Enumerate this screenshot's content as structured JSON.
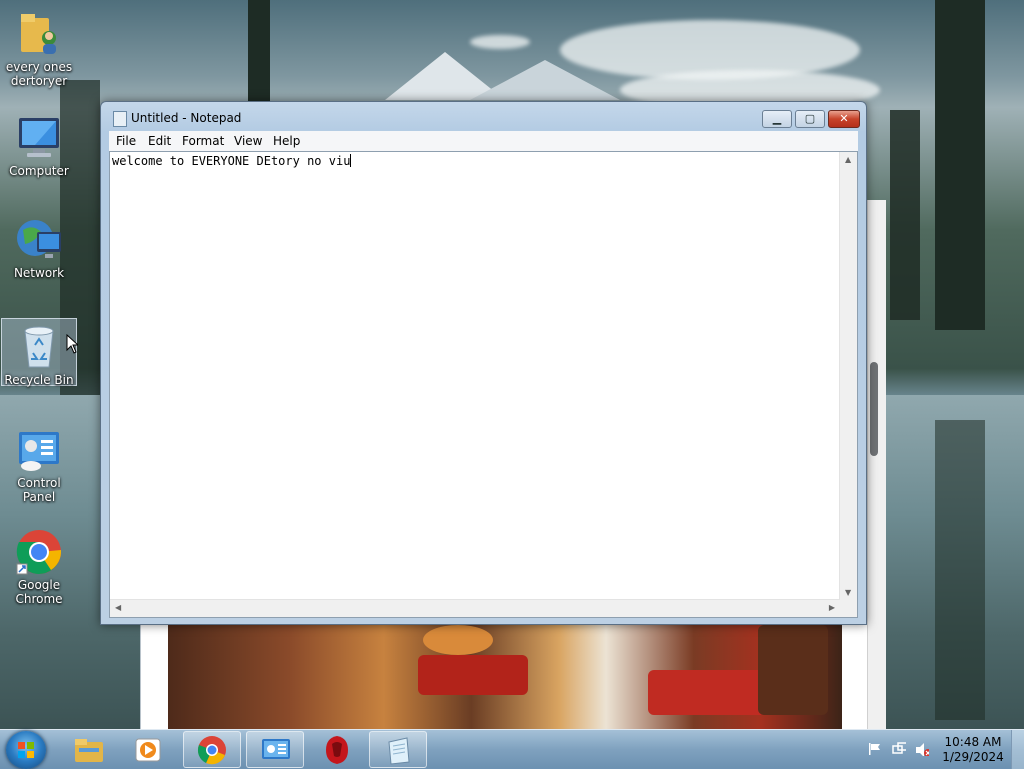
{
  "desktop": {
    "icons": [
      {
        "label": "every ones dertoryer",
        "icon": "user-folder-icon"
      },
      {
        "label": "Computer",
        "icon": "computer-icon"
      },
      {
        "label": "Network",
        "icon": "network-icon"
      },
      {
        "label": "Recycle Bin",
        "icon": "recycle-bin-icon"
      },
      {
        "label": "Control Panel",
        "icon": "control-panel-icon"
      },
      {
        "label": "Google Chrome",
        "icon": "chrome-icon"
      }
    ]
  },
  "notepad": {
    "title": "Untitled - Notepad",
    "menu": [
      "File",
      "Edit",
      "Format",
      "View",
      "Help"
    ],
    "content": "welcome to EVERYONE DEtory no viu",
    "buttons": {
      "minimize": "minimize",
      "maximize": "maximize",
      "close": "close"
    }
  },
  "taskbar": {
    "start": "start-orb-icon",
    "pinned": [
      "file-explorer-icon",
      "media-player-icon",
      "chrome-icon",
      "control-panel-icon",
      "red-app-icon",
      "notepad-icon"
    ],
    "tray": [
      "action-center-flag-icon",
      "network-icon",
      "volume-muted-icon"
    ],
    "clock": {
      "time": "10:48 AM",
      "date": "1/29/2024"
    }
  },
  "colors": {
    "taskbar": "#8aa8c6",
    "window_frame": "#bcd0e4",
    "close_button": "#c7432a"
  }
}
